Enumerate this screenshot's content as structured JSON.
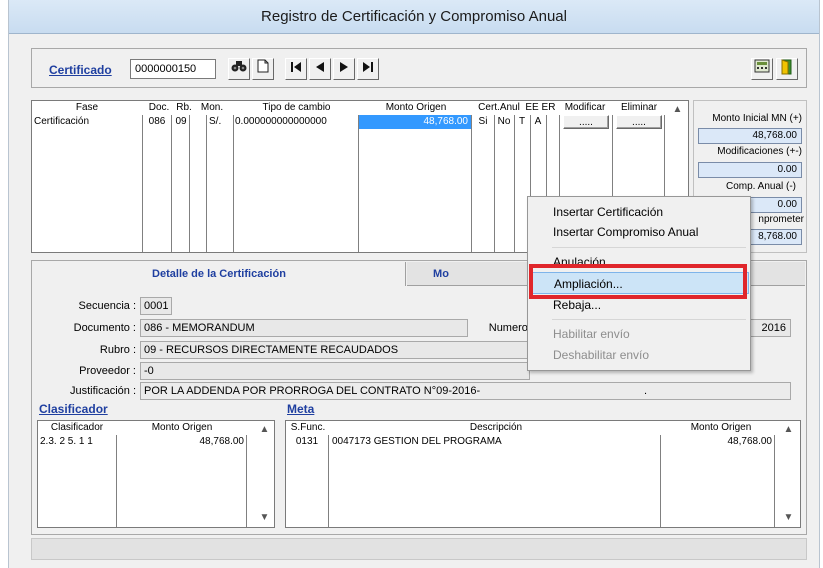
{
  "window": {
    "title": "Registro de Certificación y Compromiso Anual"
  },
  "toolbar": {
    "certificado_label": "Certificado",
    "certificado_value": "0000000150",
    "search_icon": "binoculars-icon",
    "new_icon": "new-document-icon",
    "nav": [
      "first-record-icon",
      "prev-record-icon",
      "next-record-icon",
      "last-record-icon"
    ],
    "calc_icon": "calculator-icon",
    "exit_icon": "exit-door-icon"
  },
  "phases": {
    "columns": [
      "Fase",
      "Doc.",
      "Rb.",
      "Mon.",
      "Tipo de cambio",
      "Monto Origen",
      "Cert.Anul",
      "EE",
      "ER",
      "Modificar",
      "Eliminar"
    ],
    "rows": [
      {
        "fase": "Certificación",
        "doc": "086",
        "rb": "09",
        "mon": "S/.",
        "tipo_cambio": "0.000000000000000",
        "monto": "48,768.00",
        "cert": "Si",
        "anul": "No",
        "ee": "T",
        "er": "A",
        "modificar": ".....",
        "eliminar": "....."
      }
    ]
  },
  "summary": {
    "monto_inicial_label": "Monto Inicial MN (+)",
    "monto_inicial_value": "48,768.00",
    "modificaciones_label": "Modificaciones (+-)",
    "modificaciones_value": "0.00",
    "comp_anual_label": "Comp. Anual (-)",
    "comp_anual_value": "0.00",
    "por_comprometer_label": "nprometer",
    "por_comprometer_value": "8,768.00"
  },
  "tabs": {
    "detalle": "Detalle de la Certificación",
    "second": "Mo"
  },
  "detail": {
    "secuencia_label": "Secuencia :",
    "secuencia_value": "0001",
    "documento_label": "Documento :",
    "documento_value": "086 - MEMORANDUM",
    "numero_label": "Numero :",
    "numero_value": "2016",
    "rubro_label": "Rubro :",
    "rubro_value": "09 - RECURSOS DIRECTAMENTE RECAUDADOS",
    "proveedor_label": "Proveedor :",
    "proveedor_value": "-0",
    "justificacion_label": "Justificación :",
    "justificacion_value": "POR LA ADDENDA POR PRORROGA DEL CONTRATO N°09-2016-",
    "justificacion_tail": "."
  },
  "clasificador": {
    "title": "Clasificador",
    "columns": [
      "Clasificador",
      "Monto Origen"
    ],
    "rows": [
      {
        "codigo": "2.3. 2 5. 1 1",
        "monto": "48,768.00"
      }
    ]
  },
  "meta": {
    "title": "Meta",
    "columns": [
      "S.Func.",
      "Descripción",
      "Monto Origen"
    ],
    "rows": [
      {
        "sfunc": "0131",
        "descripcion": "0047173  GESTION DEL PROGRAMA",
        "monto": "48,768.00"
      }
    ]
  },
  "context_menu": {
    "items": [
      {
        "label": "Insertar Certificación",
        "enabled": true
      },
      {
        "label": "Insertar Compromiso Anual",
        "enabled": true
      },
      {
        "label": "Anulación",
        "enabled": true
      },
      {
        "label": "Ampliación...",
        "enabled": true,
        "highlighted": true
      },
      {
        "label": "Rebaja...",
        "enabled": true
      },
      {
        "label": "Habilitar envío",
        "enabled": false
      },
      {
        "label": "Deshabilitar envío",
        "enabled": false
      }
    ]
  },
  "colors": {
    "link": "#1f3fa0",
    "highlight_box": "#e0262b",
    "selected_cell": "#3399ff"
  }
}
